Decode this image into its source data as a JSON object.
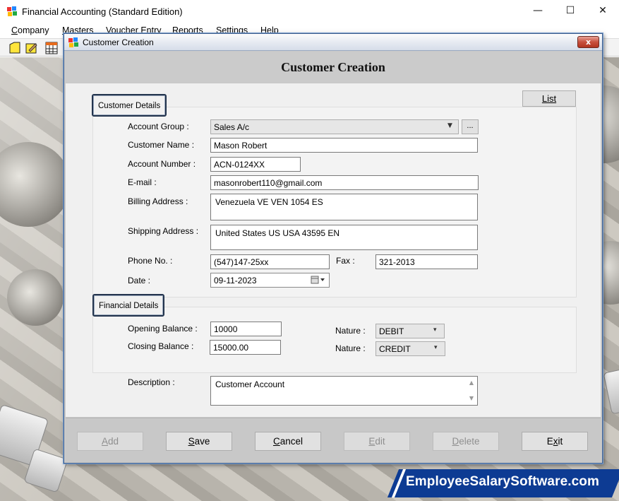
{
  "app": {
    "title": "Financial Accounting (Standard Edition)",
    "window_controls": {
      "minimize": "—",
      "maximize": "☐",
      "close": "✕"
    }
  },
  "menubar": {
    "items": [
      {
        "label": "Company",
        "mnemonic": "C"
      },
      {
        "label": "Masters",
        "mnemonic": "M"
      },
      {
        "label": "Voucher Entry",
        "mnemonic": "V"
      },
      {
        "label": "Reports",
        "mnemonic": "R"
      },
      {
        "label": "Settings",
        "mnemonic": "S"
      },
      {
        "label": "Help",
        "mnemonic": "H"
      }
    ]
  },
  "toolbar": {
    "icons": [
      "new-document-icon",
      "edit-document-icon",
      "grid-calculator-icon"
    ]
  },
  "dialog": {
    "title": "Customer Creation",
    "heading": "Customer Creation",
    "close_label": "x",
    "list_button": "List",
    "customer_section": {
      "label": "Customer Details",
      "account_group_label": "Account Group :",
      "account_group_value": "Sales A/c",
      "browse_label": "...",
      "customer_name_label": "Customer Name :",
      "customer_name_value": "Mason Robert",
      "account_number_label": "Account Number :",
      "account_number_value": "ACN-0124XX",
      "email_label": "E-mail :",
      "email_value": "masonrobert110@gmail.com",
      "billing_label": "Billing Address :",
      "billing_value": "Venezuela VE VEN 1054 ES",
      "shipping_label": "Shipping Address :",
      "shipping_value": "United States US USA 43595 EN",
      "phone_label": "Phone No. :",
      "phone_value": "(547)147-25xx",
      "fax_label": "Fax :",
      "fax_value": "321-2013",
      "date_label": "Date :",
      "date_value": "09-11-2023"
    },
    "financial_section": {
      "label": "Financial Details",
      "opening_label": "Opening Balance :",
      "opening_value": "10000",
      "closing_label": "Closing Balance :",
      "closing_value": "15000.00",
      "nature1_label": "Nature :",
      "nature1_value": "DEBIT",
      "nature2_label": "Nature :",
      "nature2_value": "CREDIT"
    },
    "description_label": "Description :",
    "description_value": "Customer Account",
    "footer_buttons": [
      {
        "label": "Add",
        "mnemonic": "A",
        "enabled": false
      },
      {
        "label": "Save",
        "mnemonic": "S",
        "enabled": true
      },
      {
        "label": "Cancel",
        "mnemonic": "C",
        "enabled": true
      },
      {
        "label": "Edit",
        "mnemonic": "E",
        "enabled": false
      },
      {
        "label": "Delete",
        "mnemonic": "D",
        "enabled": false
      },
      {
        "label": "Exit",
        "mnemonic": "x",
        "enabled": true
      }
    ]
  },
  "watermark": {
    "text": "EmployeeSalarySoftware.com"
  },
  "colors": {
    "banner_blue": "#0d3b93",
    "section_border": "#23344d",
    "dialog_border": "#3f5e8c",
    "close_red": "#c8503d"
  }
}
